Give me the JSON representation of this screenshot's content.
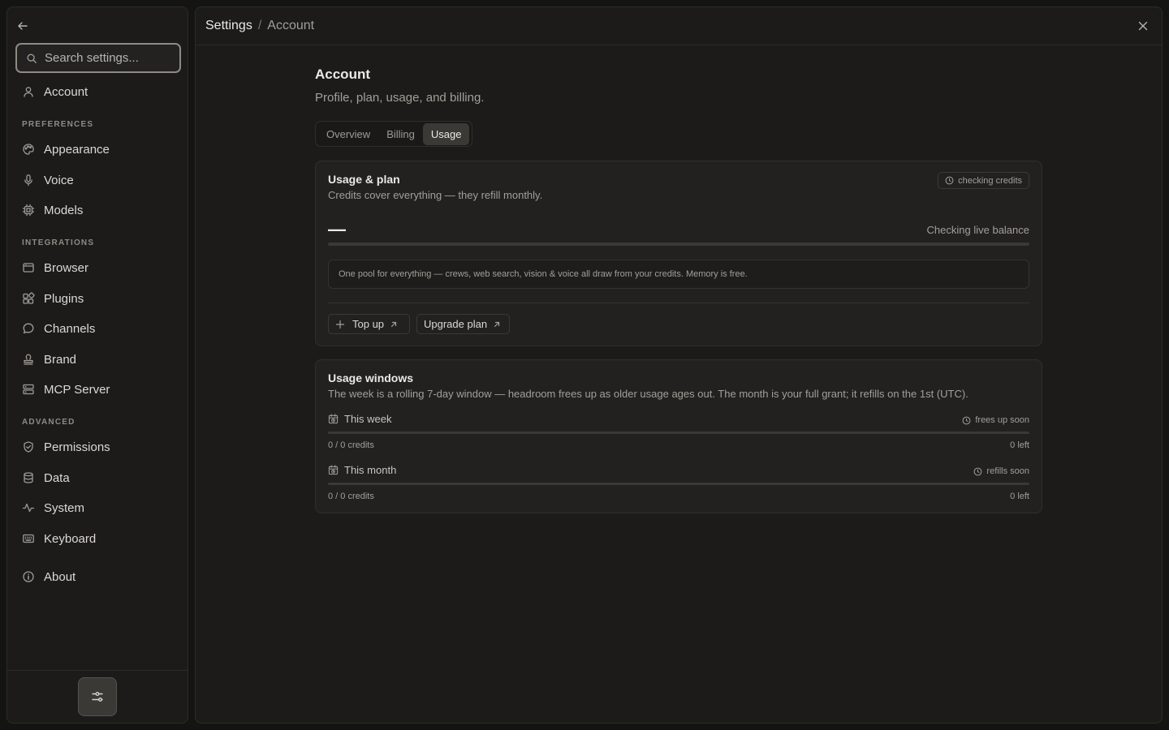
{
  "sidebar": {
    "search_placeholder": "Search settings...",
    "account_label": "Account",
    "sections": {
      "preferences": "PREFERENCES",
      "integrations": "INTEGRATIONS",
      "advanced": "ADVANCED"
    },
    "items": {
      "appearance": "Appearance",
      "voice": "Voice",
      "models": "Models",
      "browser": "Browser",
      "plugins": "Plugins",
      "channels": "Channels",
      "brand": "Brand",
      "mcp_server": "MCP Server",
      "permissions": "Permissions",
      "data": "Data",
      "system": "System",
      "keyboard": "Keyboard",
      "about": "About"
    }
  },
  "header": {
    "breadcrumb_root": "Settings",
    "breadcrumb_sep": "/",
    "breadcrumb_current": "Account"
  },
  "page": {
    "title": "Account",
    "subtitle": "Profile, plan, usage, and billing."
  },
  "tabs": {
    "overview": "Overview",
    "billing": "Billing",
    "usage": "Usage",
    "active": "usage"
  },
  "usage_plan": {
    "title": "Usage & plan",
    "subtitle": "Credits cover everything — they refill monthly.",
    "chip": "checking credits",
    "balance": "—",
    "balance_status": "Checking live balance",
    "note": "One pool for everything — crews, web search, vision & voice all draw from your credits. Memory is free.",
    "topup_label": "Top up",
    "upgrade_label": "Upgrade plan"
  },
  "usage_windows": {
    "title": "Usage windows",
    "subtitle": "The week is a rolling 7-day window — headroom frees up as older usage ages out. The month is your full grant; it refills on the 1st (UTC).",
    "week": {
      "label": "This week",
      "status": "frees up soon",
      "credits": "0 / 0 credits",
      "left": "0 left"
    },
    "month": {
      "label": "This month",
      "status": "refills soon",
      "credits": "0 / 0 credits",
      "left": "0 left"
    }
  },
  "icons": {
    "back": "arrow-left-icon",
    "search": "search-icon",
    "close": "close-icon",
    "settings_toggle": "sliders-icon"
  },
  "colors": {
    "background": "#141413",
    "panel": "#1c1b1a",
    "card": "#222120",
    "active_tab": "#3a3936",
    "text_primary": "#ebe9e5",
    "text_muted": "#a29f99"
  }
}
